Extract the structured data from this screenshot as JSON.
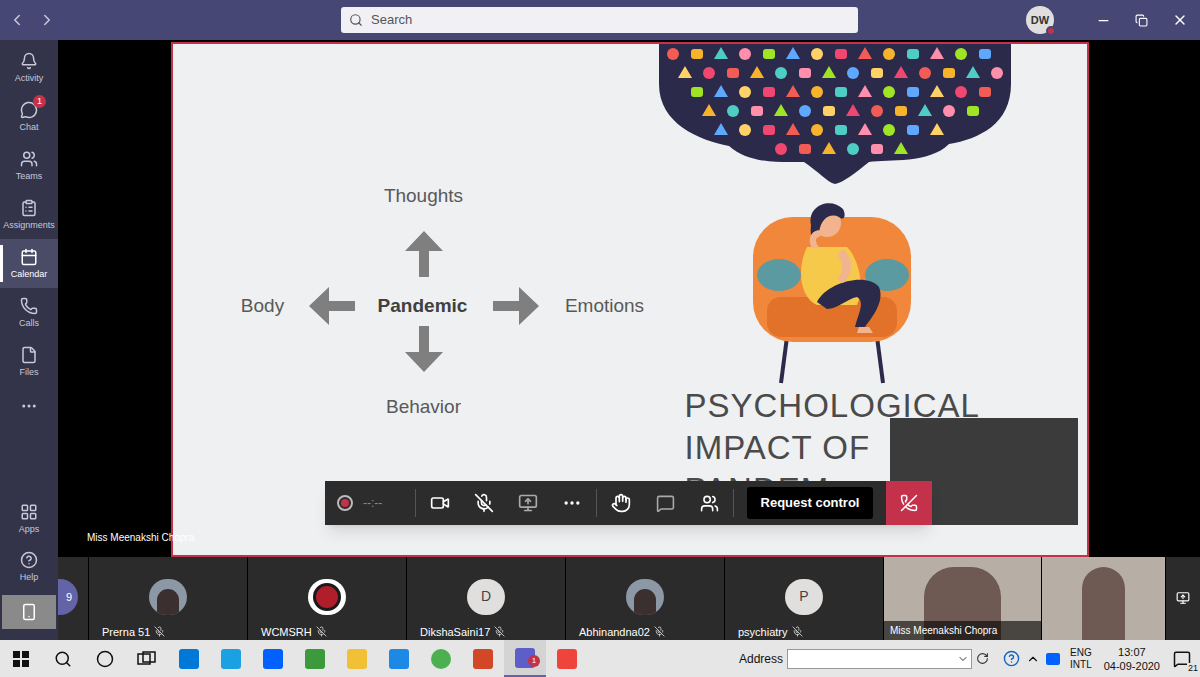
{
  "window": {
    "search_placeholder": "Search",
    "avatar_initials": "DW",
    "presence_busy": true
  },
  "rail": {
    "items": [
      {
        "label": "Activity",
        "selected": false,
        "badge": ""
      },
      {
        "label": "Chat",
        "selected": false,
        "badge": "1"
      },
      {
        "label": "Teams",
        "selected": false,
        "badge": ""
      },
      {
        "label": "Assignments",
        "selected": false,
        "badge": ""
      },
      {
        "label": "Calendar",
        "selected": true,
        "badge": ""
      },
      {
        "label": "Calls",
        "selected": false,
        "badge": ""
      },
      {
        "label": "Files",
        "selected": false,
        "badge": ""
      }
    ],
    "bottom": [
      {
        "label": "Apps"
      },
      {
        "label": "Help"
      }
    ]
  },
  "slide": {
    "diagram": {
      "center": "Pandemic",
      "top": "Thoughts",
      "left": "Body",
      "right": "Emotions",
      "bottom": "Behavior"
    },
    "title_lines": [
      "PSYCHOLOGICAL",
      "IMPACT OF",
      "PANDEM"
    ]
  },
  "presenter_label": "Miss Meenakshi Chopra",
  "controls": {
    "recording": false,
    "timer": "--:--",
    "camera_on": true,
    "mic_muted": true,
    "request_control": "Request control"
  },
  "participants": [
    {
      "name": "",
      "kind": "partial",
      "initial": "9",
      "muted": false
    },
    {
      "name": "Prerna 51",
      "kind": "photo",
      "initial": "",
      "muted": true
    },
    {
      "name": "WCMSRH",
      "kind": "logo",
      "initial": "",
      "muted": true
    },
    {
      "name": "DikshaSaini17",
      "kind": "initial",
      "initial": "D",
      "muted": true
    },
    {
      "name": "Abhinandna02",
      "kind": "photo",
      "initial": "",
      "muted": true
    },
    {
      "name": "psychiatry",
      "kind": "initial",
      "initial": "P",
      "muted": true
    },
    {
      "name": "Miss Meenakshi Chopra",
      "kind": "video",
      "initial": "",
      "muted": false
    },
    {
      "name": "",
      "kind": "video",
      "initial": "",
      "muted": false
    },
    {
      "name": "",
      "kind": "edge",
      "initial": "",
      "muted": false
    }
  ],
  "taskbar": {
    "teams_badge": "1",
    "address_label": "Address",
    "address_value": "",
    "language": "ENG",
    "layout": "INTL",
    "time": "13:07",
    "date": "04-09-2020",
    "notifications": "21"
  }
}
